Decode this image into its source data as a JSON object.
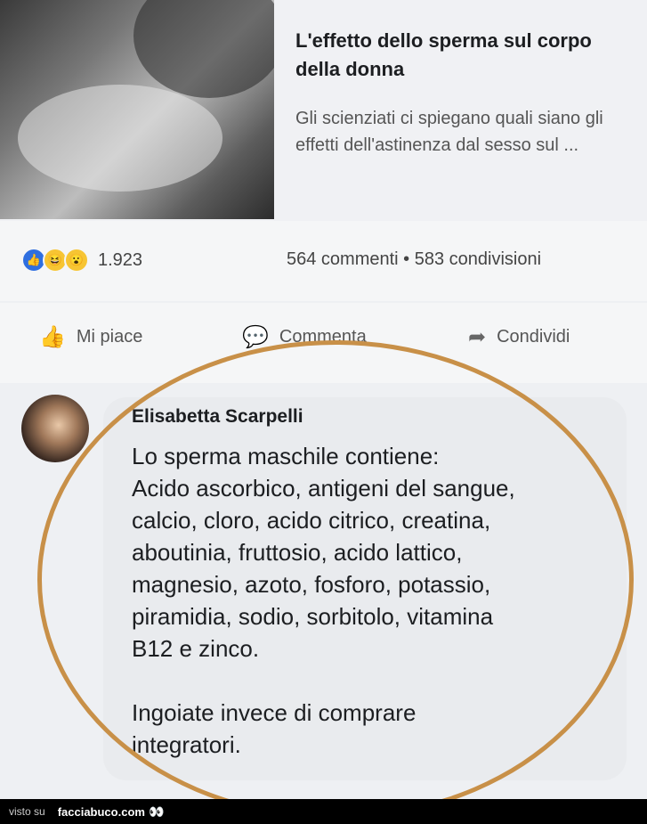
{
  "link": {
    "title": "L'effetto dello sperma sul corpo della donna",
    "description": "Gli scienziati ci spiegano quali siano gli effetti dell'astinenza dal sesso sul ..."
  },
  "stats": {
    "reaction_icons": [
      "like-icon",
      "haha-icon",
      "wow-icon"
    ],
    "reaction_count": "1.923",
    "comments_shares": "564 commenti • 583 condivisioni"
  },
  "actions": {
    "like_label": "Mi piace",
    "comment_label": "Commenta",
    "share_label": "Condividi"
  },
  "comment": {
    "author": "Elisabetta Scarpelli",
    "lines": [
      "Lo sperma maschile contiene:",
      "Acido ascorbico, antigeni del sangue,",
      "calcio, cloro, acido citrico, creatina,",
      "aboutinia, fruttosio, acido lattico,",
      "magnesio, azoto, fosforo, potassio,",
      "piramidia, sodio, sorbitolo, vitamina",
      "B12 e zinco."
    ],
    "closing": [
      "Ingoiate invece di comprare",
      "integratori."
    ]
  },
  "footer": {
    "visto_su": "visto su",
    "site": "facciabuco.com"
  },
  "colors": {
    "annotation_circle": "#c89048",
    "like_blue": "#2f6fe0"
  }
}
